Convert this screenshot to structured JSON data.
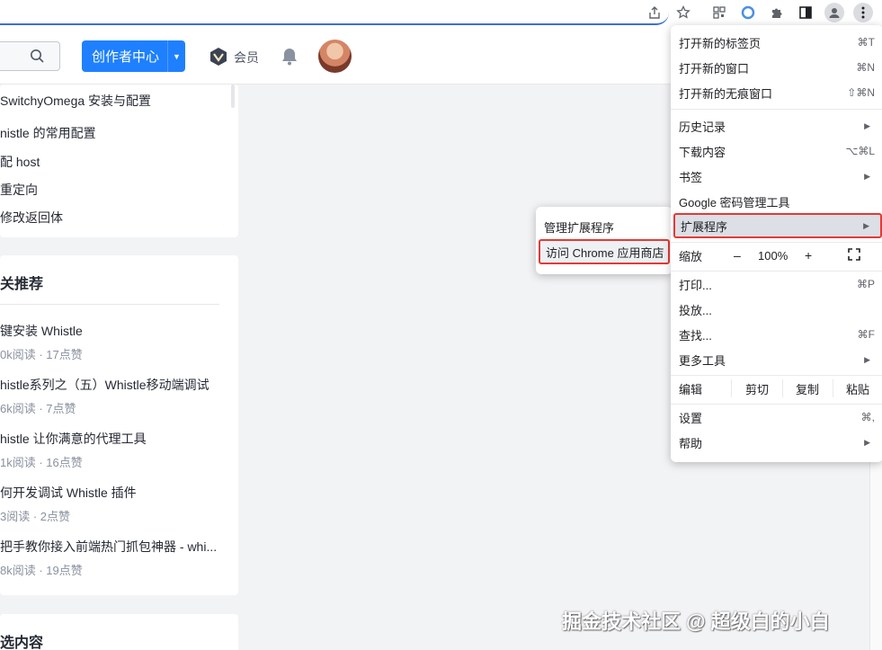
{
  "toolbar": {
    "icons": [
      "share-icon",
      "star-icon",
      "qr-icon",
      "extension-circle-icon",
      "puzzle-icon",
      "sidepanel-icon",
      "profile-icon",
      "menu-dots-icon"
    ]
  },
  "header": {
    "creator_button": "创作者中心",
    "vip_label": "会员"
  },
  "toc": {
    "items": [
      "SwitchyOmega 安装与配置",
      "nistle 的常用配置",
      "配 host",
      "重定向",
      "修改返回体"
    ]
  },
  "recommend": {
    "title": "关推荐",
    "articles": [
      {
        "title": "键安装 Whistle",
        "meta": "0k阅读 · 17点赞"
      },
      {
        "title": "histle系列之（五）Whistle移动端调试",
        "meta": "6k阅读 · 7点赞"
      },
      {
        "title": "histle 让你满意的代理工具",
        "meta": "1k阅读 · 16点赞"
      },
      {
        "title": "何开发调试 Whistle 插件",
        "meta": "3阅读 · 2点赞"
      },
      {
        "title": "把手教你接入前端热门抓包神器 - whi...",
        "meta": "8k阅读 · 19点赞"
      }
    ]
  },
  "selected": {
    "title": "选内容"
  },
  "menu": {
    "new_tab": {
      "label": "打开新的标签页",
      "shortcut": "⌘T"
    },
    "new_window": {
      "label": "打开新的窗口",
      "shortcut": "⌘N"
    },
    "incognito": {
      "label": "打开新的无痕窗口",
      "shortcut": "⇧⌘N"
    },
    "history": {
      "label": "历史记录"
    },
    "downloads": {
      "label": "下载内容",
      "shortcut": "⌥⌘L"
    },
    "bookmarks": {
      "label": "书签"
    },
    "passwords": {
      "label": "Google 密码管理工具"
    },
    "extensions": {
      "label": "扩展程序"
    },
    "zoom": {
      "label": "缩放",
      "minus": "–",
      "value": "100%",
      "plus": "+"
    },
    "print": {
      "label": "打印...",
      "shortcut": "⌘P"
    },
    "cast": {
      "label": "投放..."
    },
    "find": {
      "label": "查找...",
      "shortcut": "⌘F"
    },
    "more_tools": {
      "label": "更多工具"
    },
    "edit": {
      "label": "编辑",
      "cut": "剪切",
      "copy": "复制",
      "paste": "粘贴"
    },
    "settings": {
      "label": "设置",
      "shortcut": "⌘,"
    },
    "help": {
      "label": "帮助"
    }
  },
  "submenu": {
    "manage": "管理扩展程序",
    "store": "访问 Chrome 应用商店"
  },
  "watermark": "掘金技术社区 @ 超级白的小白",
  "colors": {
    "brand_blue": "#1e80ff",
    "highlight_red": "#e53935",
    "page_bg": "#f2f3f5"
  }
}
